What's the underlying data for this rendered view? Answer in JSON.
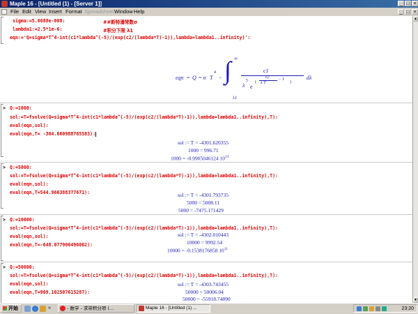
{
  "window": {
    "title": "Maple 16 - [Untitled (1) - [Server 1]]"
  },
  "menu": [
    "File",
    "Edit",
    "View",
    "Insert",
    "Format",
    "Spreadsheet",
    "Window",
    "Help"
  ],
  "doc": {
    "setup": {
      "line1": "sigma:=5.6688e-008:",
      "comment1": "##斯特潘常数σ",
      "line2": "lambda1:=2.5*1e-6:",
      "comment2": "#积分下限 λ1",
      "line3": "eqn:='Q=sigma*T^4-int(c1*lambda^(-5)/(exp(c2/(lambda*T)-1)),lambda=lambda1..infinity)':"
    },
    "equation": {
      "lhs": "eqn",
      "eq1": "=",
      "Q": "Q",
      "eq2": "= σ",
      "T": "T",
      "exp4": "4",
      "minus": "−",
      "int_sym": "∫",
      "upper": "∞",
      "lower": "λ1",
      "c1": "c1",
      "lam": "λ",
      "exp5": "5",
      "e": "e",
      "c2": "c2",
      "lamT": "λ T",
      "m1": "− 1",
      "d": "dλ"
    },
    "blocks": [
      {
        "prompt": ">",
        "q": "Q:=1000:",
        "sol": "sol:=T=fsolve(Q=sigma*T^4-int(c1*lambda^(-5)/(exp(c2/(lambda*T)-1)),lambda=lambda1..infinity),T):",
        "ev1": "eval(eqn,sol):",
        "ev2": "eval(eqn,T= -364.660988765583):",
        "out_sol": "sol := T = -4301.620355",
        "out_a": "1000 = 996.71",
        "out_b": "1000 = -0.9905046124 10",
        "out_b_exp": "13"
      },
      {
        "prompt": ">",
        "q": "Q:=5000:",
        "sol": "sol:=T=fsolve(Q=sigma*T^4-int(c1*lambda^(-5)/(exp(c2/(lambda*T)-1)),lambda=lambda1..infinity),T):",
        "ev1": "eval(eqn,sol):",
        "ev2": "eval(eqn,T=544.966388377671):",
        "out_sol": "sol := T = -4301.793735",
        "out_a": "5000 = 5008.11",
        "out_b": "5000 = -7475.171429",
        "out_b_exp": ""
      },
      {
        "prompt": ">",
        "q": "Q:=10000:",
        "sol": "sol:=T=fsolve(Q=sigma*T^4-int(c1*lambda^(-5)/(exp(c2/(lambda*T)-1)),lambda=lambda1..infinity),T):",
        "ev1": "eval(eqn,sol):",
        "ev2": "eval(eqn,T=-648.077906496062):",
        "out_sol": "sol := T = -4302.010443",
        "out_a": "10000 = 9992.54",
        "out_b": "10000 = -0.1538176858 10",
        "out_b_exp": "11"
      },
      {
        "prompt": ">",
        "q": "Q:=50000:",
        "sol": "sol:=T=fsolve(Q=sigma*T^4-int(c1*lambda^(-5)/(exp(c2/(lambda*T)-1)),lambda=lambda1..infinity),T):",
        "ev1": "eval(eqn,sol):",
        "ev2": "eval(eqn,T=969.102507615287):",
        "out_sol": "sol := T = -4303.743455",
        "out_a": "50000 = 50006.04",
        "out_b": "50000 = -55918.74890",
        "out_b_exp": ""
      }
    ]
  },
  "taskbar": {
    "start": "开始",
    "tasks": [
      "- 数学 - 求带积分项 (...",
      "Maple 16 - [Untitled (1) ..."
    ],
    "clock": "23:20"
  }
}
